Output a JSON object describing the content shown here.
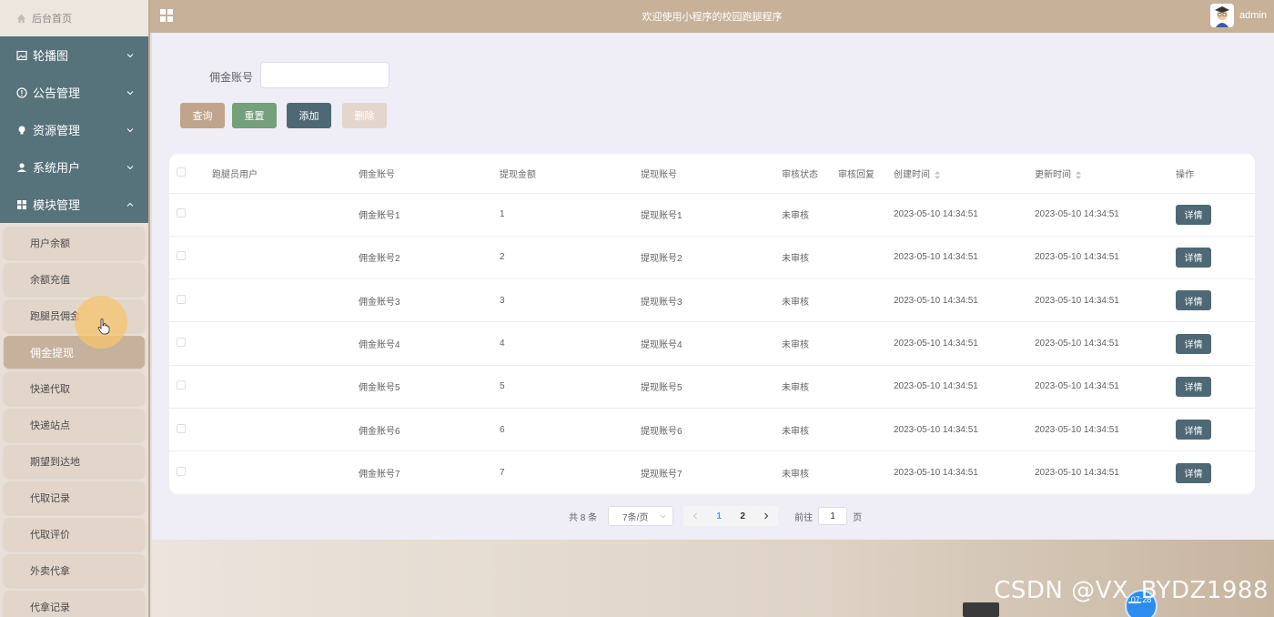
{
  "sidebar": {
    "home_label": "后台首页",
    "menus": [
      {
        "label": "轮播图",
        "icon": "image-icon",
        "expanded": false
      },
      {
        "label": "公告管理",
        "icon": "info-circle-icon",
        "expanded": false
      },
      {
        "label": "资源管理",
        "icon": "bulb-icon",
        "expanded": false
      },
      {
        "label": "系统用户",
        "icon": "user-icon",
        "expanded": false
      },
      {
        "label": "模块管理",
        "icon": "grid-icon",
        "expanded": true
      }
    ],
    "submenu": [
      {
        "label": "用户余额",
        "active": false
      },
      {
        "label": "余额充值",
        "active": false
      },
      {
        "label": "跑腿员佣金",
        "active": false
      },
      {
        "label": "佣金提现",
        "active": true
      },
      {
        "label": "快递代取",
        "active": false
      },
      {
        "label": "快递站点",
        "active": false
      },
      {
        "label": "期望到达地",
        "active": false
      },
      {
        "label": "代取记录",
        "active": false
      },
      {
        "label": "代取评价",
        "active": false
      },
      {
        "label": "外卖代拿",
        "active": false
      },
      {
        "label": "代拿记录",
        "active": false
      }
    ]
  },
  "header": {
    "title": "欢迎使用小程序的校园跑腿程序",
    "username": "admin"
  },
  "search": {
    "label": "佣金账号",
    "value": "",
    "placeholder": ""
  },
  "buttons": {
    "query": "查询",
    "reset": "重置",
    "add": "添加",
    "delete": "删除"
  },
  "table": {
    "columns": [
      "跑腿员用户",
      "佣金账号",
      "提现金额",
      "提现账号",
      "审核状态",
      "审核回复",
      "创建时间",
      "更新时间",
      "操作"
    ],
    "rows": [
      {
        "runner": "",
        "account": "佣金账号1",
        "amount": "1",
        "withdraw_account": "提现账号1",
        "status": "未审核",
        "reply": "",
        "created": "2023-05-10 14:34:51",
        "updated": "2023-05-10 14:34:51",
        "action": "详情"
      },
      {
        "runner": "",
        "account": "佣金账号2",
        "amount": "2",
        "withdraw_account": "提现账号2",
        "status": "未审核",
        "reply": "",
        "created": "2023-05-10 14:34:51",
        "updated": "2023-05-10 14:34:51",
        "action": "详情"
      },
      {
        "runner": "",
        "account": "佣金账号3",
        "amount": "3",
        "withdraw_account": "提现账号3",
        "status": "未审核",
        "reply": "",
        "created": "2023-05-10 14:34:51",
        "updated": "2023-05-10 14:34:51",
        "action": "详情"
      },
      {
        "runner": "",
        "account": "佣金账号4",
        "amount": "4",
        "withdraw_account": "提现账号4",
        "status": "未审核",
        "reply": "",
        "created": "2023-05-10 14:34:51",
        "updated": "2023-05-10 14:34:51",
        "action": "详情"
      },
      {
        "runner": "",
        "account": "佣金账号5",
        "amount": "5",
        "withdraw_account": "提现账号5",
        "status": "未审核",
        "reply": "",
        "created": "2023-05-10 14:34:51",
        "updated": "2023-05-10 14:34:51",
        "action": "详情"
      },
      {
        "runner": "",
        "account": "佣金账号6",
        "amount": "6",
        "withdraw_account": "提现账号6",
        "status": "未审核",
        "reply": "",
        "created": "2023-05-10 14:34:51",
        "updated": "2023-05-10 14:34:51",
        "action": "详情"
      },
      {
        "runner": "",
        "account": "佣金账号7",
        "amount": "7",
        "withdraw_account": "提现账号7",
        "status": "未审核",
        "reply": "",
        "created": "2023-05-10 14:34:51",
        "updated": "2023-05-10 14:34:51",
        "action": "详情"
      }
    ]
  },
  "pagination": {
    "total": "共 8 条",
    "page_size": "7条/页",
    "pages": [
      "1",
      "2"
    ],
    "current": "1",
    "goto_label": "前往",
    "goto_value": "1",
    "page_unit": "页"
  },
  "overlay": {
    "watermark": "CSDN @VX_BYDZ1988",
    "clock": "07:28"
  },
  "colors": {
    "topbar": "#c7b299",
    "sidebar_menu": "#56727b",
    "active_submenu": "#c6b29c",
    "query_button": "#c0a58c",
    "reset_button": "#74a07b",
    "add_button": "#4e6974",
    "delete_button": "#e3d6cc"
  }
}
